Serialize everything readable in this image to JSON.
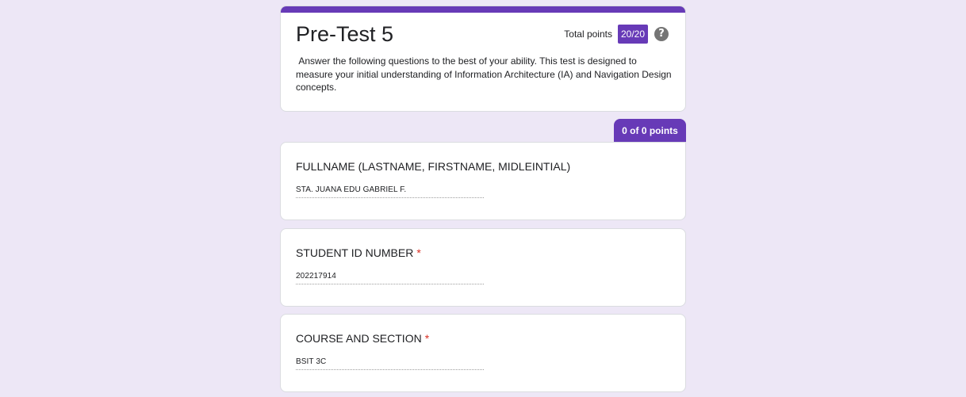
{
  "form": {
    "title": "Pre-Test 5",
    "total_points_label": "Total points",
    "total_points_value": "20/20",
    "description": " Answer the following questions to the best of your ability. This test is designed to measure your initial understanding of Information Architecture (IA) and Navigation Design concepts.",
    "accent_color": "#673ab7",
    "background_color": "#ede7f6"
  },
  "section": {
    "points_label": "0 of 0 points"
  },
  "questions": [
    {
      "title": "FULLNAME (LASTNAME, FIRSTNAME, MIDLEINTIAL)",
      "required": false,
      "answer": "STA. JUANA EDU GABRIEL F."
    },
    {
      "title": "STUDENT ID NUMBER",
      "required": true,
      "required_marker": "*",
      "answer": "202217914"
    },
    {
      "title": "COURSE AND SECTION",
      "required": true,
      "required_marker": "*",
      "answer": "BSIT 3C"
    }
  ],
  "icons": {
    "help": "help-circle-icon"
  }
}
